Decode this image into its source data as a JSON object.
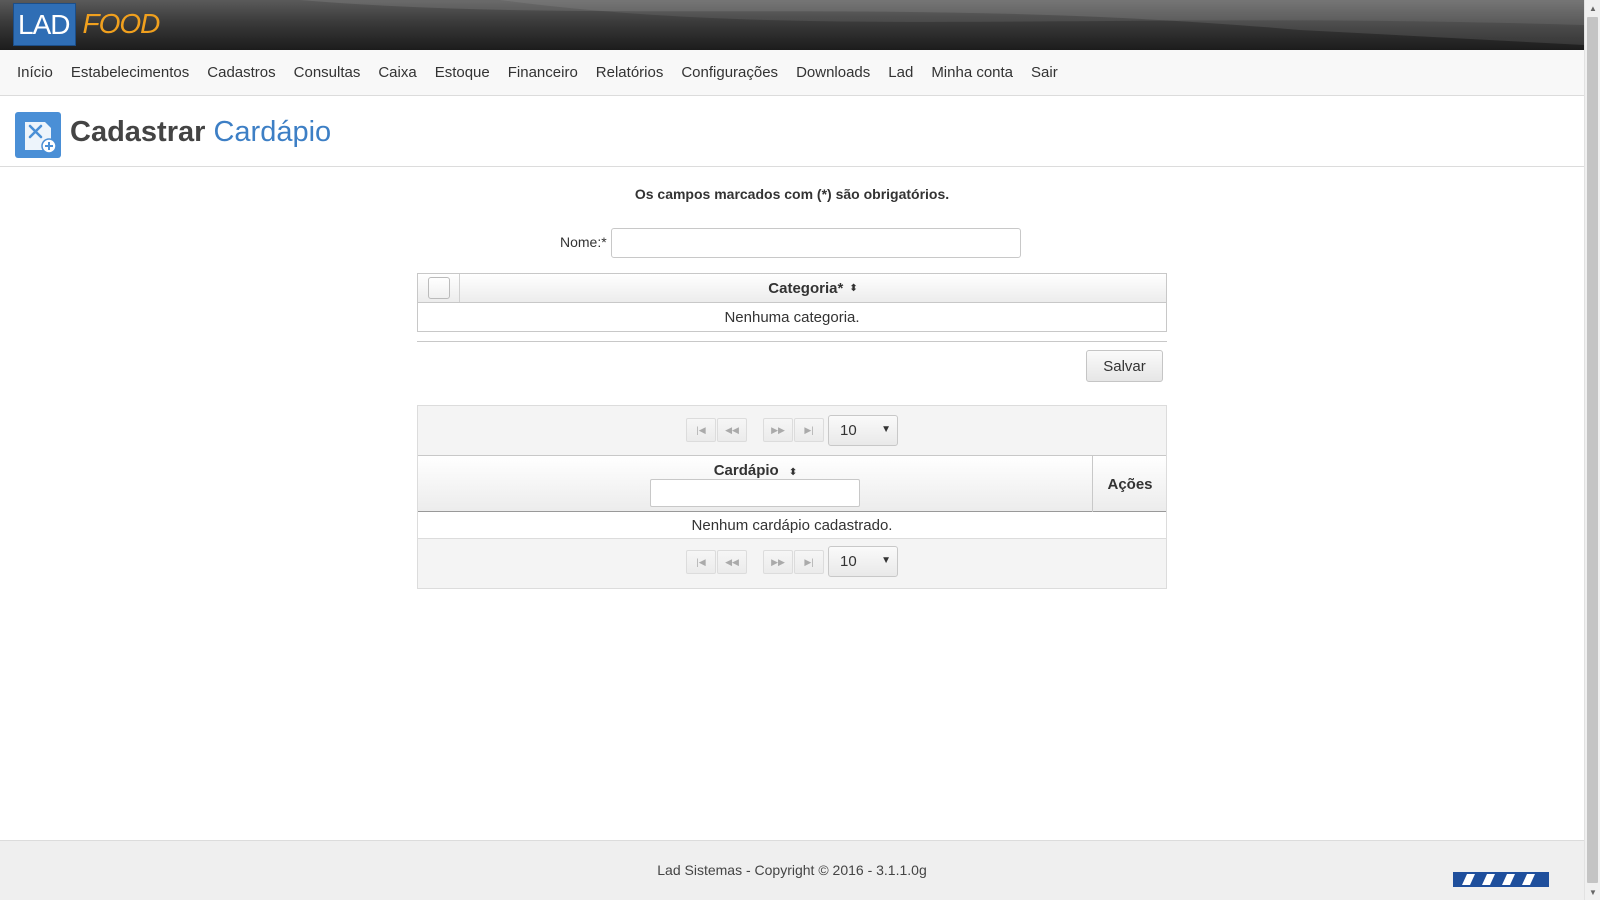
{
  "logo": {
    "part1": "LAD",
    "part2": "FOOD"
  },
  "nav": {
    "items": [
      {
        "label": "Início"
      },
      {
        "label": "Estabelecimentos"
      },
      {
        "label": "Cadastros"
      },
      {
        "label": "Consultas"
      },
      {
        "label": "Caixa"
      },
      {
        "label": "Estoque"
      },
      {
        "label": "Financeiro"
      },
      {
        "label": "Relatórios"
      },
      {
        "label": "Configurações"
      },
      {
        "label": "Downloads"
      },
      {
        "label": "Lad"
      },
      {
        "label": "Minha conta"
      },
      {
        "label": "Sair"
      }
    ]
  },
  "page": {
    "title_main": "Cadastrar",
    "title_accent": "Cardápio",
    "icon": "menu-add-icon"
  },
  "form": {
    "required_note": "Os campos marcados com (*) são obrigatórios.",
    "name_label": "Nome:*",
    "name_value": "",
    "categories": {
      "column_header": "Categoria*",
      "empty_message": "Nenhuma categoria."
    },
    "save_label": "Salvar"
  },
  "list": {
    "rows_per_page": "10",
    "pager_icons": [
      "first-page-icon",
      "prev-page-icon",
      "next-page-icon",
      "last-page-icon"
    ],
    "column_cardapio": "Cardápio",
    "column_acoes": "Ações",
    "filter_value": "",
    "empty_message": "Nenhum cardápio cadastrado."
  },
  "footer": {
    "text": "Lad Sistemas - Copyright © 2016 - 3.1.1.0g"
  },
  "colors": {
    "brand_blue": "#2f6eb5",
    "brand_orange": "#f0a01e",
    "accent_title": "#3d7fc5"
  }
}
